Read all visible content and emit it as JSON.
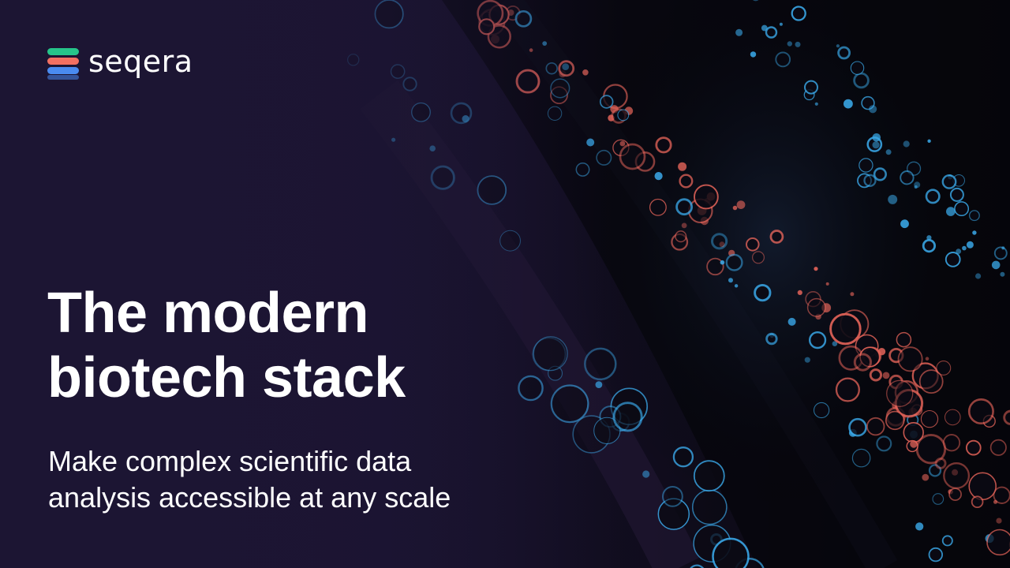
{
  "brand": {
    "name": "seqera",
    "icon": "seqera-logo-icon",
    "colors": {
      "green": "#26c48a",
      "coral": "#f27062",
      "blue": "#4a8bf0"
    }
  },
  "hero": {
    "headline_lines": [
      "The modern",
      "biotech stack"
    ],
    "subheadline_lines": [
      "Make complex scientific data",
      "analysis accessible at any scale"
    ]
  },
  "background": {
    "icon": "abstract-cell-bubbles-image",
    "colors": {
      "base": "#1c1533",
      "coral": "#e8655a",
      "cyan": "#3aa8e8"
    }
  }
}
